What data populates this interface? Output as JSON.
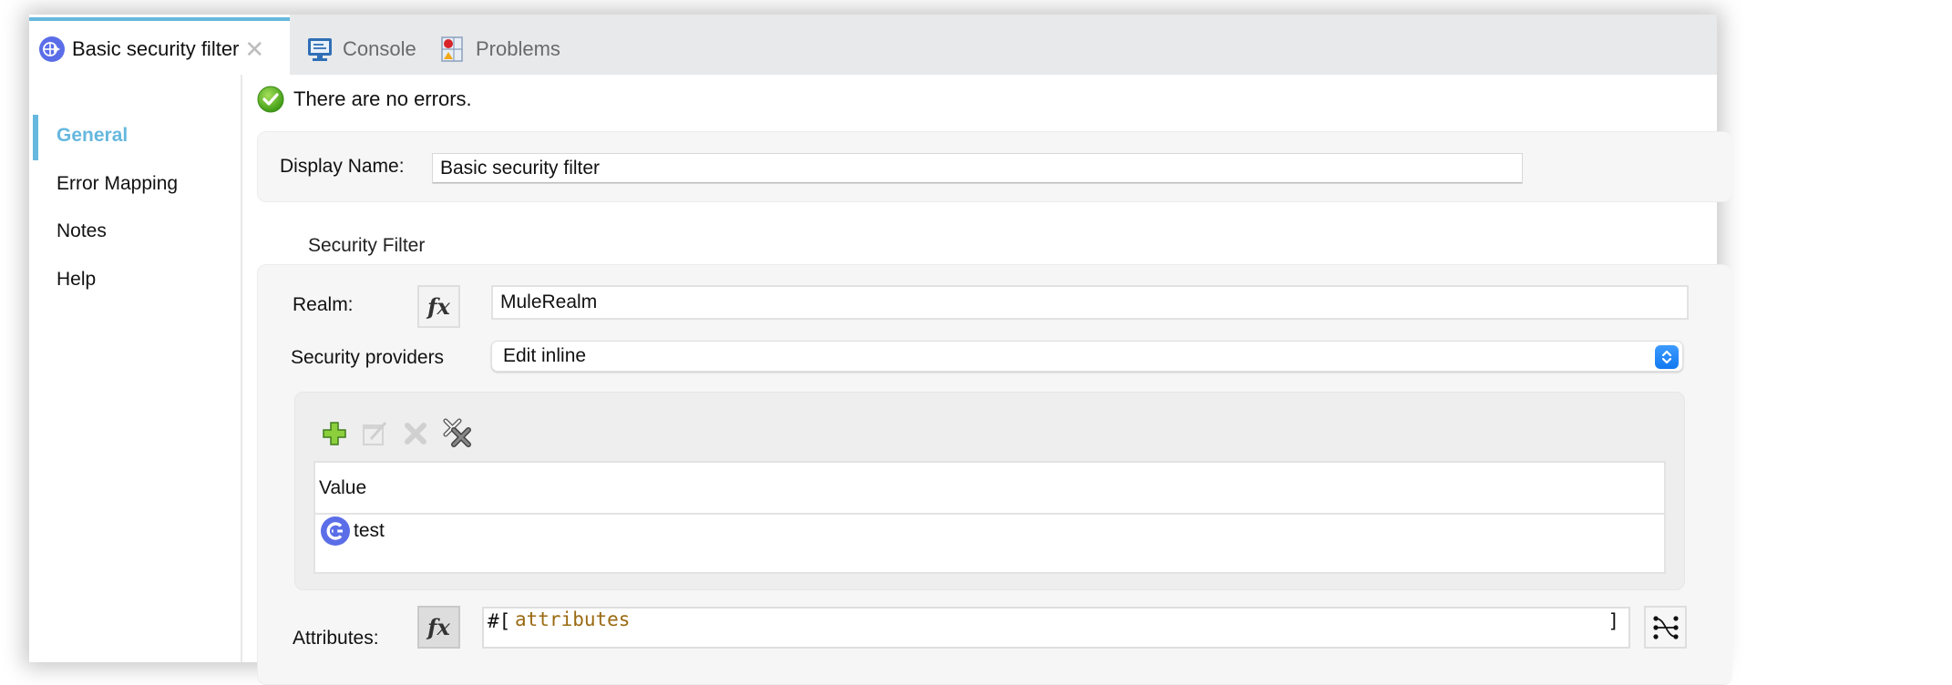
{
  "tabs": [
    {
      "label": "Basic security filter",
      "icon": "mule-component-icon",
      "active": true,
      "closable": true
    },
    {
      "label": "Console",
      "icon": "console-icon",
      "active": false
    },
    {
      "label": "Problems",
      "icon": "problems-icon",
      "active": false
    }
  ],
  "sidebar": {
    "items": [
      {
        "label": "General",
        "active": true
      },
      {
        "label": "Error Mapping",
        "active": false
      },
      {
        "label": "Notes",
        "active": false
      },
      {
        "label": "Help",
        "active": false
      }
    ]
  },
  "status": {
    "text": "There are no errors.",
    "icon": "check-circle-icon"
  },
  "general": {
    "display_name_label": "Display Name:",
    "display_name_value": "Basic security filter"
  },
  "security_filter": {
    "section_title": "Security Filter",
    "realm_label": "Realm:",
    "realm_value": "MuleRealm",
    "fx_label": "fx",
    "providers_label": "Security providers",
    "providers_selected": "Edit inline",
    "toolbar": {
      "add": "add-icon",
      "edit": "edit-icon",
      "delete": "delete-icon",
      "remove_all": "remove-all-icon"
    },
    "table": {
      "header": "Value",
      "rows": [
        {
          "value": "test",
          "icon": "connector-icon"
        }
      ]
    },
    "attributes_label": "Attributes:",
    "attributes_prefix": "#[",
    "attributes_expression": "attributes",
    "attributes_suffix": "]"
  },
  "colors": {
    "accent": "#66b8de",
    "dropdown_button": "#1a80f5",
    "expression_text": "#9a6a12",
    "component_icon": "#5b6ee8",
    "success": "#5cb82a"
  }
}
